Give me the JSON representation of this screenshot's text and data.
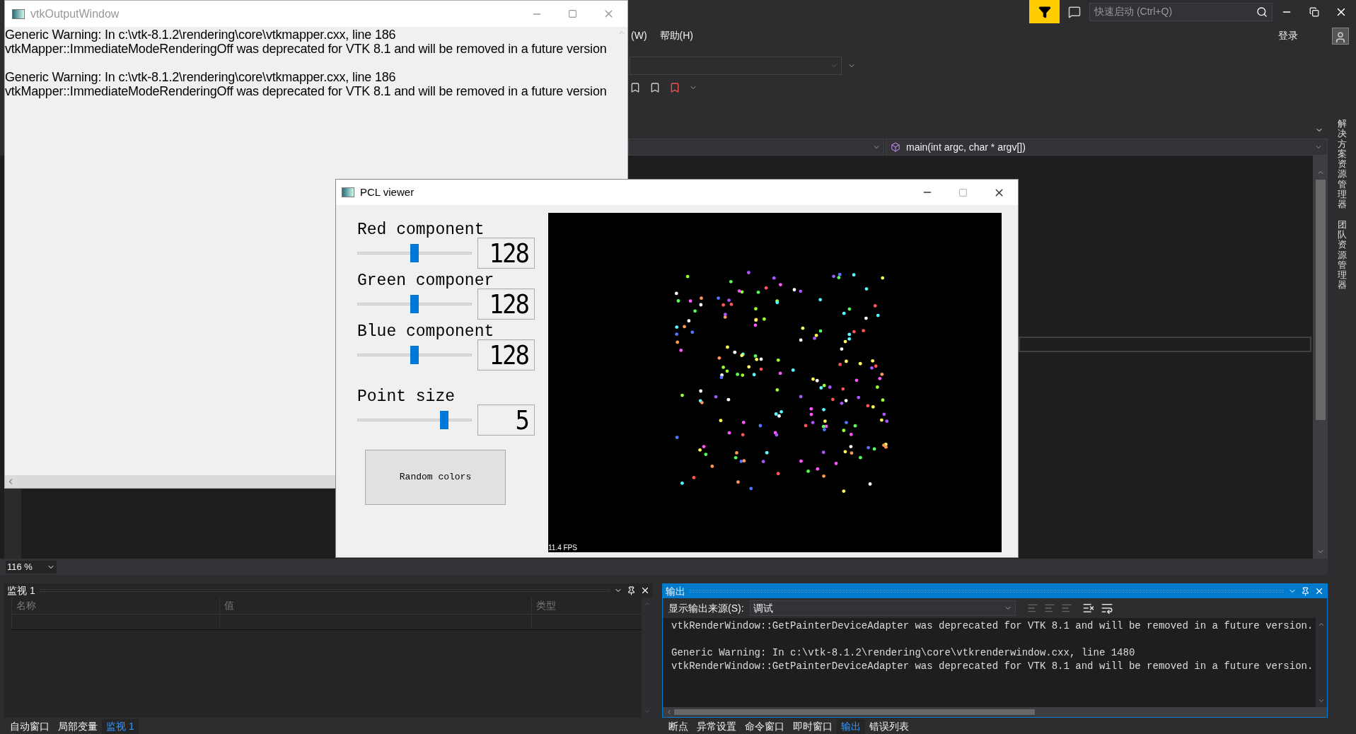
{
  "vs": {
    "menu": [
      "(W)",
      "帮助(H)"
    ],
    "quick_launch": {
      "placeholder": "快速启动 (Ctrl+Q)"
    },
    "sign_in": "登录",
    "nav_function": "main(int argc, char * argv[])",
    "side_tabs": [
      "解决方案资源管理器",
      "团队资源管理器"
    ],
    "zoom": "116 %"
  },
  "watch": {
    "title": "监视 1",
    "columns": [
      "名称",
      "值",
      "类型"
    ]
  },
  "left_tabs": [
    {
      "label": "自动窗口",
      "selected": false
    },
    {
      "label": "局部变量",
      "selected": false
    },
    {
      "label": "监视 1",
      "selected": true
    }
  ],
  "output": {
    "title": "输出",
    "source_label": "显示输出来源(S):",
    "source": "调试",
    "messages": [
      {
        "lines": [
          "vtkRenderWindow::GetPainterDeviceAdapter was deprecated for VTK 8.1 and will be removed in a future version."
        ]
      },
      {
        "lines": [
          "Generic Warning: In c:\\vtk-8.1.2\\rendering\\core\\vtkrenderwindow.cxx, line 1480",
          "vtkRenderWindow::GetPainterDeviceAdapter was deprecated for VTK 8.1 and will be removed in a future version."
        ]
      }
    ]
  },
  "bottom_tabs": [
    {
      "label": "断点",
      "selected": false
    },
    {
      "label": "异常设置",
      "selected": false
    },
    {
      "label": "命令窗口",
      "selected": false
    },
    {
      "label": "即时窗口",
      "selected": false
    },
    {
      "label": "输出",
      "selected": true
    },
    {
      "label": "错误列表",
      "selected": false
    }
  ],
  "vtk_window": {
    "title": "vtkOutputWindow",
    "messages": [
      {
        "lines": [
          "Generic Warning: In c:\\vtk-8.1.2\\rendering\\core\\vtkmapper.cxx, line 186",
          "vtkMapper::ImmediateModeRenderingOff was deprecated for VTK 8.1 and will be removed in a future version"
        ]
      },
      {
        "lines": [
          "Generic Warning: In c:\\vtk-8.1.2\\rendering\\core\\vtkmapper.cxx, line 186",
          "vtkMapper::ImmediateModeRenderingOff was deprecated for VTK 8.1 and will be removed in a future version"
        ]
      }
    ]
  },
  "pcl_viewer": {
    "title": "PCL viewer",
    "controls": [
      {
        "label": "Red component",
        "level": 0.5,
        "reading": "128"
      },
      {
        "label": "Green componer",
        "level": 0.5,
        "reading": "128"
      },
      {
        "label": "Blue component",
        "level": 0.5,
        "reading": "128"
      },
      {
        "label": "Point size",
        "level": 0.78,
        "reading": "5"
      }
    ],
    "button": "Random colors",
    "fps": "11.4 FPS"
  }
}
